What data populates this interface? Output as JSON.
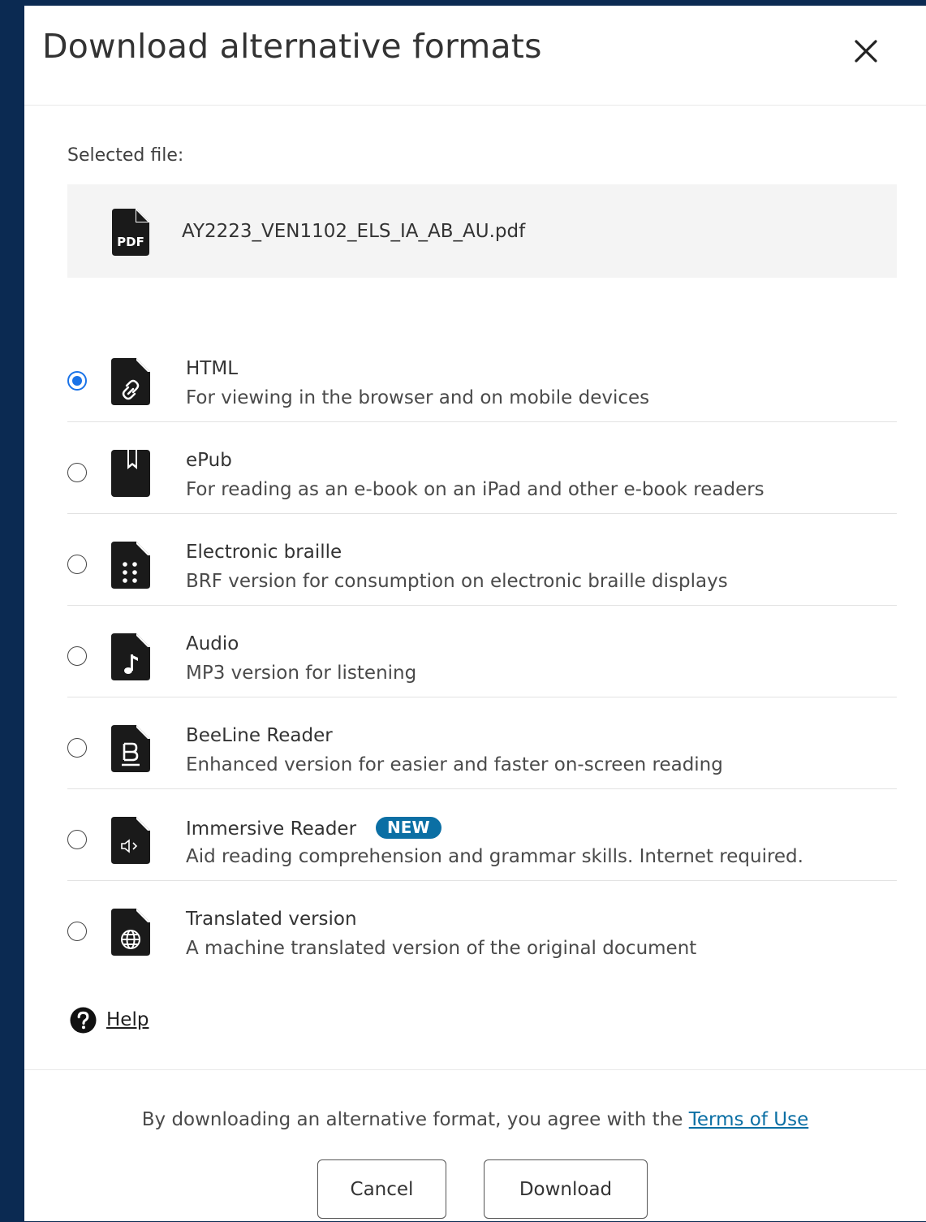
{
  "dialog": {
    "title": "Download alternative formats",
    "close_icon": "close-icon"
  },
  "selected_file": {
    "label": "Selected file:",
    "file_type_icon": "pdf-file-icon",
    "file_type_text": "PDF",
    "file_name": "AY2223_VEN1102_ELS_IA_AB_AU.pdf"
  },
  "formats": [
    {
      "icon": "html-link-file-icon",
      "title": "HTML",
      "description": "For viewing in the browser and on mobile devices",
      "selected": true
    },
    {
      "icon": "epub-book-icon",
      "title": "ePub",
      "description": "For reading as an e-book on an iPad and other e-book readers",
      "selected": false
    },
    {
      "icon": "braille-file-icon",
      "title": "Electronic braille",
      "description": "BRF version for consumption on electronic braille displays",
      "selected": false
    },
    {
      "icon": "audio-file-icon",
      "title": "Audio",
      "description": "MP3 version for listening",
      "selected": false
    },
    {
      "icon": "beeline-file-icon",
      "title": "BeeLine Reader",
      "description": "Enhanced version for easier and faster on-screen reading",
      "selected": false
    },
    {
      "icon": "immersive-reader-file-icon",
      "title": "Immersive Reader",
      "badge": "NEW",
      "description": "Aid reading comprehension and grammar skills. Internet required.",
      "selected": false
    },
    {
      "icon": "translated-globe-file-icon",
      "title": "Translated version",
      "description": "A machine translated version of the original document",
      "selected": false
    }
  ],
  "help": {
    "icon": "help-question-icon",
    "label": "Help"
  },
  "footer": {
    "terms_prefix": "By downloading an alternative format, you agree with the ",
    "terms_link": "Terms of Use",
    "cancel_label": "Cancel",
    "download_label": "Download"
  },
  "colors": {
    "backdrop": "#0b2a52",
    "radio_selected": "#1a73e8",
    "badge": "#0b6fa4",
    "link": "#0b6fa4"
  }
}
